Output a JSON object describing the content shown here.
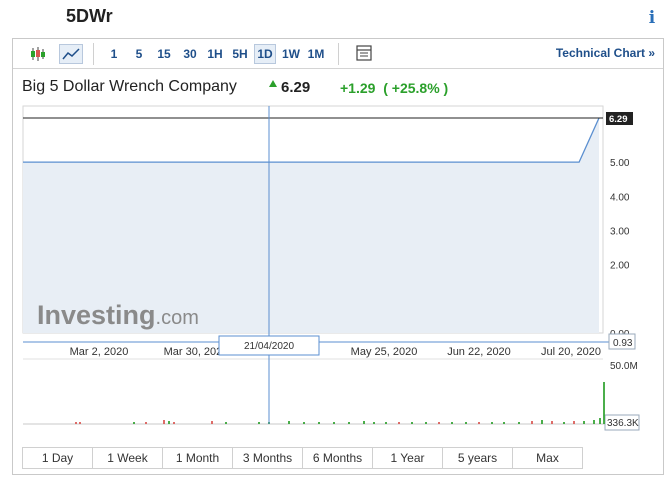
{
  "header": {
    "symbol": "5DWr",
    "info_icon": "info-icon"
  },
  "toolbar": {
    "icons": [
      "candlestick-icon",
      "line-chart-icon",
      "table-icon"
    ],
    "intervals": [
      "1",
      "5",
      "15",
      "30",
      "1H",
      "5H",
      "1D",
      "1W",
      "1M"
    ],
    "active_interval": "1D",
    "technical_chart_label": "Technical Chart »"
  },
  "quote": {
    "company": "Big 5 Dollar Wrench Company",
    "direction_icon": "arrow-up-icon",
    "price": "6.29",
    "change": "+1.29",
    "change_pct": "( +25.8% )"
  },
  "colors": {
    "up": "#2ba02b",
    "down": "#d9534f",
    "line": "#5b8fd0",
    "area": "#e8eef5",
    "link": "#1f4f8a"
  },
  "watermark": "Investing.com",
  "chart_data": {
    "type": "area",
    "x_ticks": [
      "Mar 2, 2020",
      "Mar 30, 2020",
      "May 25, 2020",
      "Jun 22, 2020",
      "Jul 20, 2020"
    ],
    "y_ticks": [
      "5.00",
      "4.00",
      "3.00",
      "2.00",
      "0.00"
    ],
    "ylim": [
      0,
      6.29
    ],
    "series": [
      {
        "values": [
          5.0,
          5.0,
          5.0,
          5.0,
          5.0,
          5.0,
          5.0,
          5.0,
          5.0,
          5.0,
          5.0,
          5.0,
          5.0,
          5.0,
          5.0,
          5.0,
          5.0,
          5.0,
          5.0,
          5.0,
          5.0,
          5.0,
          5.0,
          5.0,
          5.0,
          5.0,
          5.0,
          5.0,
          5.0,
          6.29
        ]
      }
    ],
    "last_price_label": "6.29",
    "crosshair": {
      "date": "21/04/2020",
      "value_label": "0.93"
    },
    "volume": {
      "max_label": "50.0M",
      "last_label": "336.3K"
    }
  },
  "ranges": [
    "1 Day",
    "1 Week",
    "1 Month",
    "3 Months",
    "6 Months",
    "1 Year",
    "5 years",
    "Max"
  ]
}
